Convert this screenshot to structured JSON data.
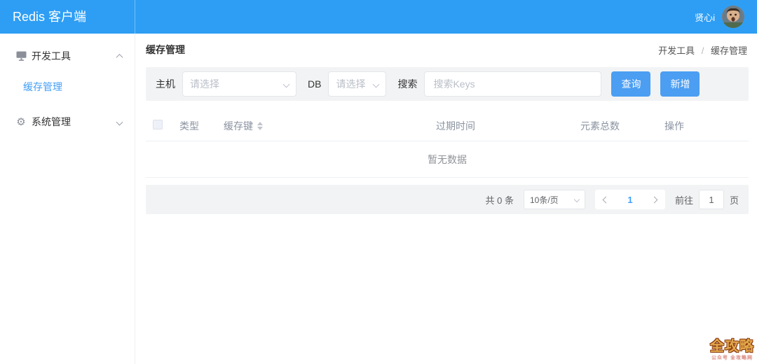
{
  "app": {
    "title": "Redis 客户端"
  },
  "user": {
    "name": "贤心i"
  },
  "sidebar": {
    "groups": [
      {
        "label": "开发工具",
        "icon": "monitor-icon",
        "state": "expanded"
      },
      {
        "label": "系统管理",
        "icon": "gear-icon",
        "state": "collapsed"
      }
    ],
    "active_item": "缓存管理"
  },
  "page": {
    "title": "缓存管理",
    "breadcrumb": [
      "开发工具",
      "缓存管理"
    ],
    "breadcrumb_separator": "/"
  },
  "filters": {
    "host_label": "主机",
    "host_placeholder": "请选择",
    "db_label": "DB",
    "db_placeholder": "请选择",
    "search_label": "搜索",
    "search_placeholder": "搜索Keys",
    "query_button": "查询",
    "add_button": "新增"
  },
  "table": {
    "columns": [
      "类型",
      "缓存键",
      "过期时间",
      "元素总数",
      "操作"
    ],
    "sortable_column": "缓存键",
    "empty_text": "暂无数据",
    "rows": []
  },
  "pagination": {
    "total_text": "共 0 条",
    "page_size": "10条/页",
    "current_page": "1",
    "goto_label": "前往",
    "goto_value": "1",
    "goto_suffix": "页"
  },
  "watermark": {
    "text": "全攻略",
    "subtext": "公众号 全攻略网"
  },
  "colors": {
    "header": "#2e9ef4",
    "primary": "#4b9ef2",
    "active_link": "#449ff7",
    "page_num": "#409eff"
  }
}
